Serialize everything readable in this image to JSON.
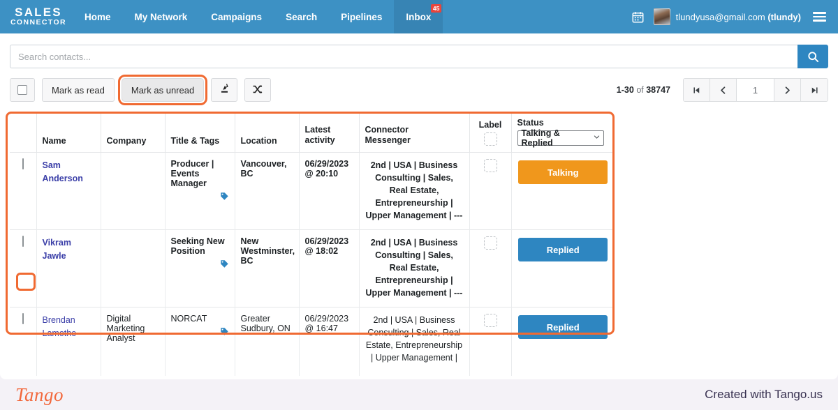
{
  "navbar": {
    "brand_line1": "SALES",
    "brand_line2": "CONNECTOR",
    "items": [
      {
        "label": "Home",
        "active": false
      },
      {
        "label": "My Network",
        "active": false
      },
      {
        "label": "Campaigns",
        "active": false
      },
      {
        "label": "Search",
        "active": false
      },
      {
        "label": "Pipelines",
        "active": false
      },
      {
        "label": "Inbox",
        "active": true,
        "badge": "45"
      }
    ],
    "calendar_icon": "calendar-icon",
    "user_email": "tlundyusa@gmail.com",
    "user_handle": "(tlundy)",
    "menu_icon": "hamburger-icon",
    "bg_color": "#3d91c4",
    "active_bg_color": "#3784b4",
    "badge_color": "#e8453c"
  },
  "search": {
    "placeholder": "Search contacts...",
    "value": "",
    "button_icon": "search-icon",
    "button_color": "#2e86c1"
  },
  "toolbar": {
    "select_all_label": "select-all-checkbox",
    "mark_read_label": "Mark as read",
    "mark_unread_label": "Mark as unread",
    "export_icon": "export-icon",
    "shuffle_icon": "shuffle-icon",
    "highlight_color": "#f06a32"
  },
  "pagination": {
    "range": "1-30",
    "of_label": "of",
    "total": "38747",
    "first_icon": "first-page-icon",
    "prev_icon": "previous-page-icon",
    "current_page": "1",
    "next_icon": "next-page-icon",
    "last_icon": "last-page-icon"
  },
  "table": {
    "headers": {
      "checkbox": "",
      "name": "Name",
      "company": "Company",
      "title_tags": "Title & Tags",
      "location": "Location",
      "latest_activity_l1": "Latest",
      "latest_activity_l2": "activity",
      "connector_messenger_l1": "Connector",
      "connector_messenger_l2": "Messenger",
      "label": "Label",
      "status": "Status"
    },
    "status_filter": {
      "value": "Talking & Replied",
      "chevron": "chevron-down-icon"
    },
    "rows": [
      {
        "unread": true,
        "name": "Sam Anderson",
        "company": "",
        "title": "Producer | Events Manager",
        "tag_icon": "tag-icon",
        "location": "Vancouver, BC",
        "activity_date": "06/29/2023",
        "activity_time": "@ 20:10",
        "messenger": "2nd | USA | Business Consulting | Sales, Real Estate, Entrepreneurship | Upper Management | ---",
        "label_icon": "ghost-checkbox",
        "status": "Talking",
        "status_color": "#f0971c"
      },
      {
        "unread": true,
        "name": "Vikram Jawle",
        "company": "",
        "title": "Seeking New Position",
        "tag_icon": "tag-icon",
        "location": "New Westminster, BC",
        "activity_date": "06/29/2023",
        "activity_time": "@ 18:02",
        "messenger": "2nd | USA | Business Consulting | Sales, Real Estate, Entrepreneurship | Upper Management | ---",
        "label_icon": "ghost-checkbox",
        "status": "Replied",
        "status_color": "#2e86c1"
      },
      {
        "unread": false,
        "name": "Brendan Lamothe",
        "company": "Digital Marketing Analyst",
        "title": "NORCAT",
        "tag_icon": "tag-icon",
        "location": "Greater Sudbury, ON",
        "activity_date": "06/29/2023",
        "activity_time": "@ 16:47",
        "messenger": "2nd | USA | Business Consulting | Sales, Real Estate, Entrepreneurship | Upper Management |",
        "label_icon": "ghost-checkbox",
        "status": "Replied",
        "status_color": "#2e86c1"
      }
    ]
  },
  "footer": {
    "logo_text": "Tango",
    "note": "Created with Tango.us",
    "logo_color": "#f2683c"
  }
}
